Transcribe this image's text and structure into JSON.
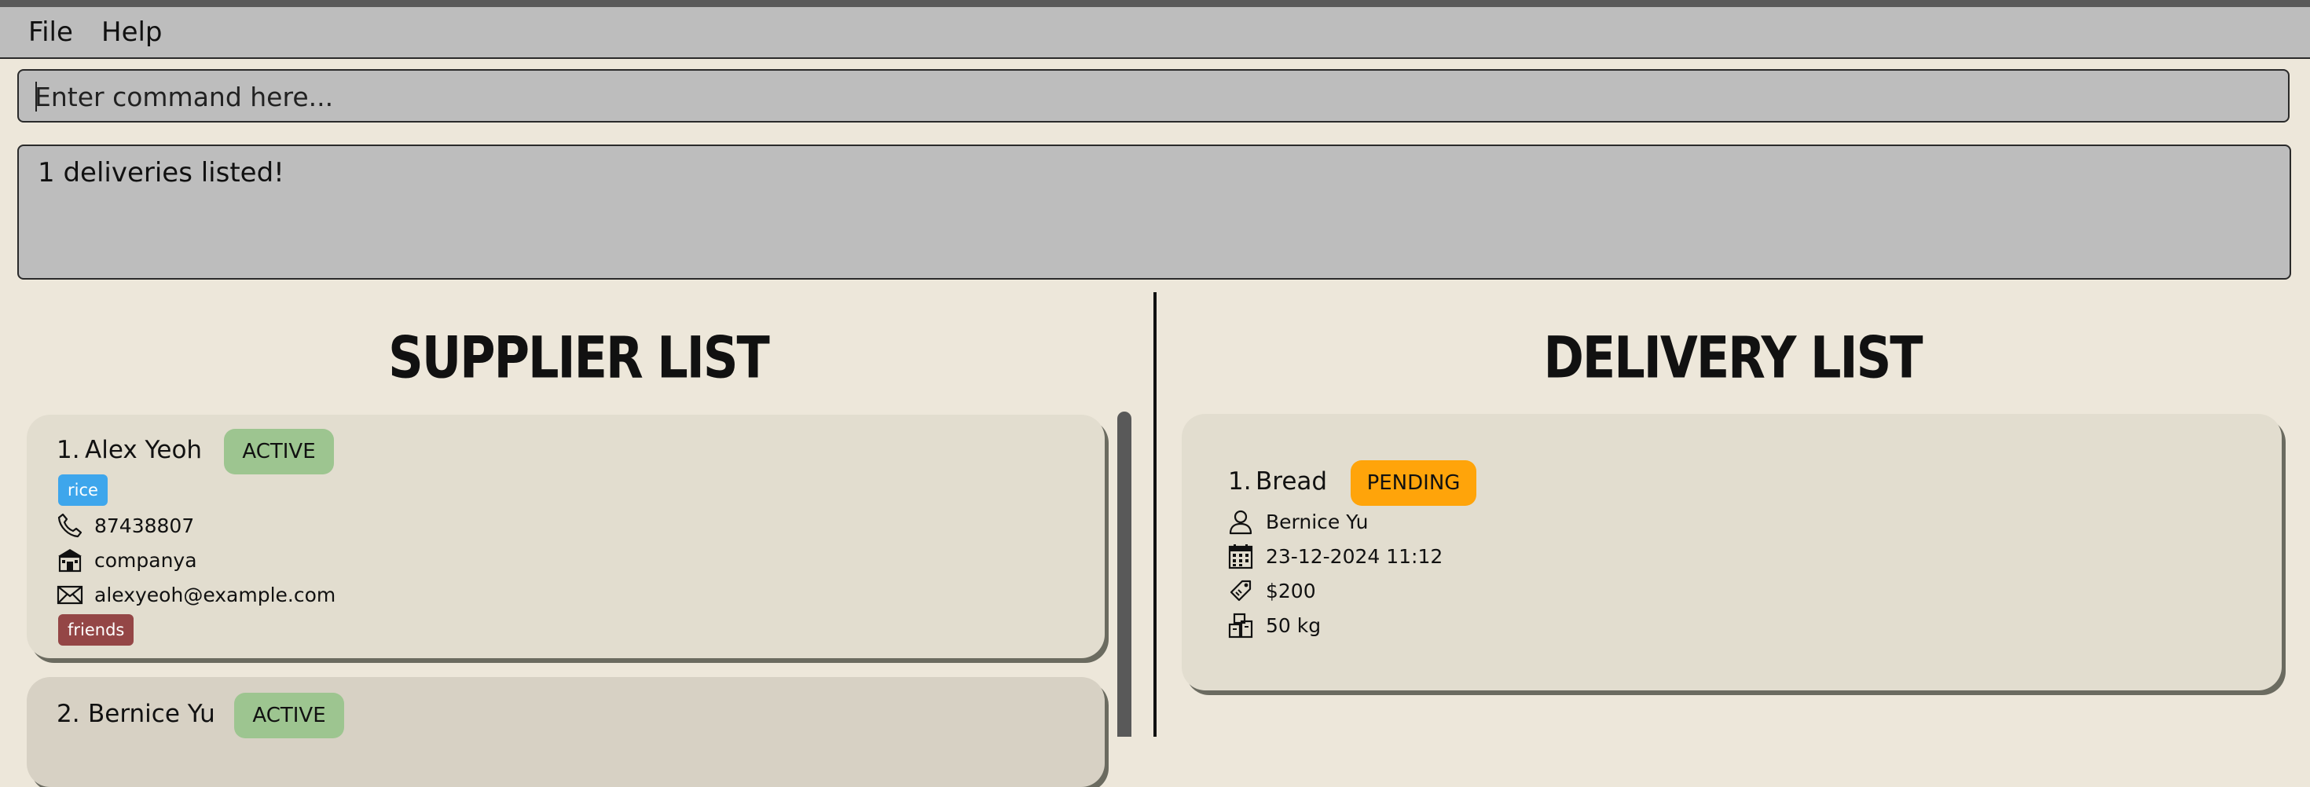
{
  "menu": {
    "file": "File",
    "help": "Help"
  },
  "command": {
    "placeholder": "Enter command here...",
    "value": ""
  },
  "result": {
    "text": "1 deliveries listed!"
  },
  "supplier_panel": {
    "title": "SUPPLIER LIST",
    "suppliers": [
      {
        "index": "1.",
        "name": "Alex Yeoh",
        "status": "ACTIVE",
        "product_tag": "rice",
        "phone": "87438807",
        "company": "companya",
        "email": "alexyeoh@example.com",
        "tag": "friends"
      },
      {
        "index": "2.",
        "name": "Bernice Yu",
        "status": "ACTIVE"
      }
    ]
  },
  "delivery_panel": {
    "title": "DELIVERY LIST",
    "deliveries": [
      {
        "index": "1.",
        "product": "Bread",
        "status": "PENDING",
        "supplier": "Bernice Yu",
        "date_time": "23-12-2024 11:12",
        "cost": "$200",
        "quantity": "50 kg"
      }
    ]
  },
  "icons": {
    "phone": "phone-icon",
    "company": "building-icon",
    "email": "envelope-icon",
    "person": "person-icon",
    "calendar": "calendar-icon",
    "cost": "price-tag-icon",
    "quantity": "boxes-icon"
  },
  "colors": {
    "background": "#ede7da",
    "bar": "#bdbdbd",
    "active": "#9dc590",
    "pending": "#ffa40a",
    "tag_blue": "#3ea6ec",
    "tag_red": "#944646"
  }
}
